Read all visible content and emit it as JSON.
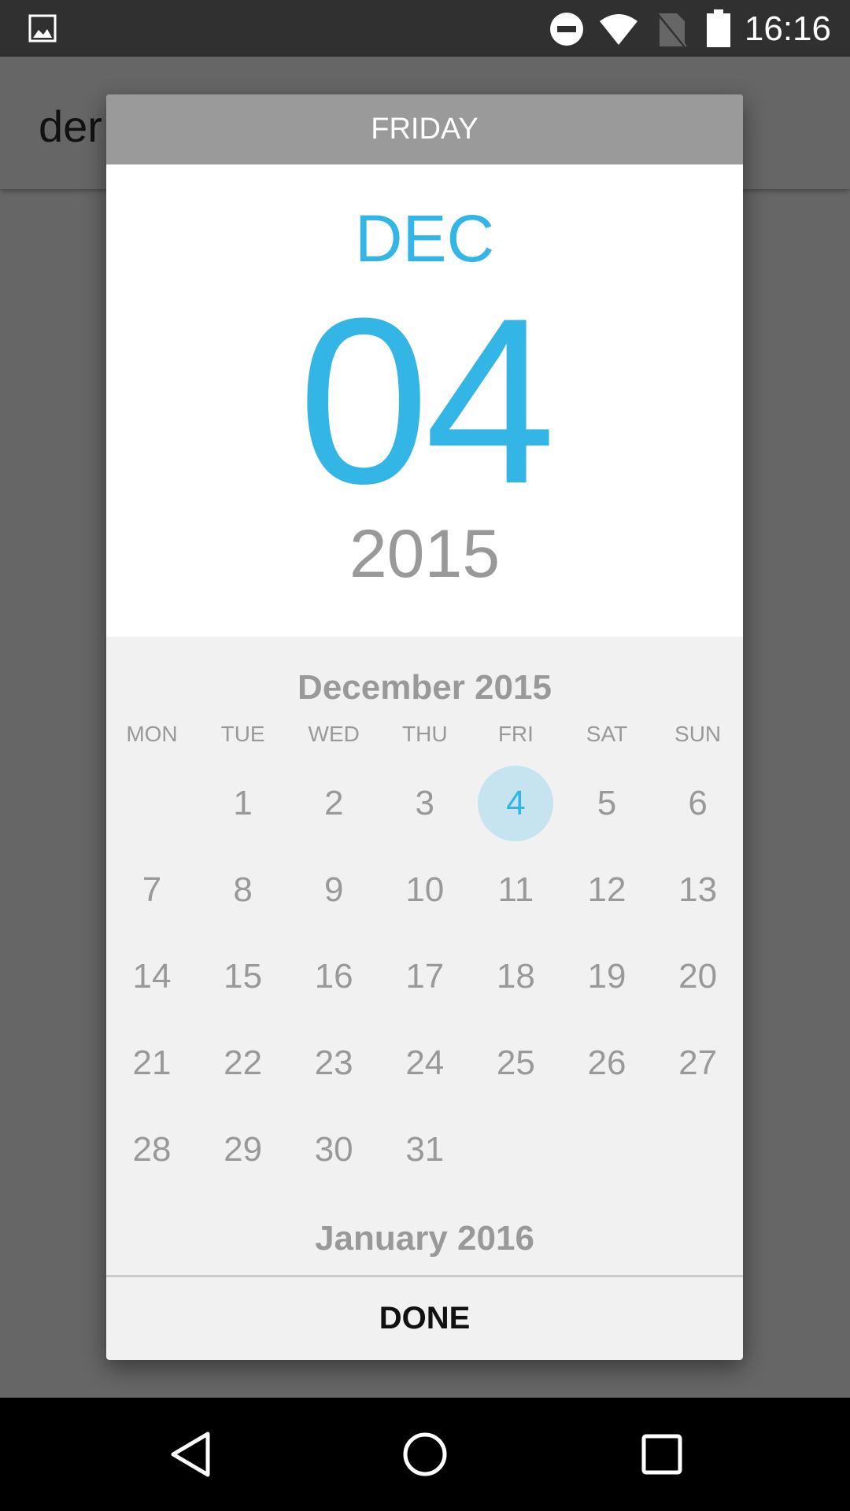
{
  "status": {
    "time": "16:16"
  },
  "app": {
    "title": "der"
  },
  "picker": {
    "weekday_header": "FRIDAY",
    "month": "DEC",
    "day": "04",
    "year": "2015",
    "current_month": "December 2015",
    "next_month": "January 2016",
    "weekdays": [
      "MON",
      "TUE",
      "WED",
      "THU",
      "FRI",
      "SAT",
      "SUN"
    ],
    "first_weekday_index": 1,
    "days_in_month": 31,
    "selected_day": 4,
    "done_label": "DONE"
  },
  "colors": {
    "accent": "#33b5e5",
    "selected_bg": "#c5e4f0"
  }
}
